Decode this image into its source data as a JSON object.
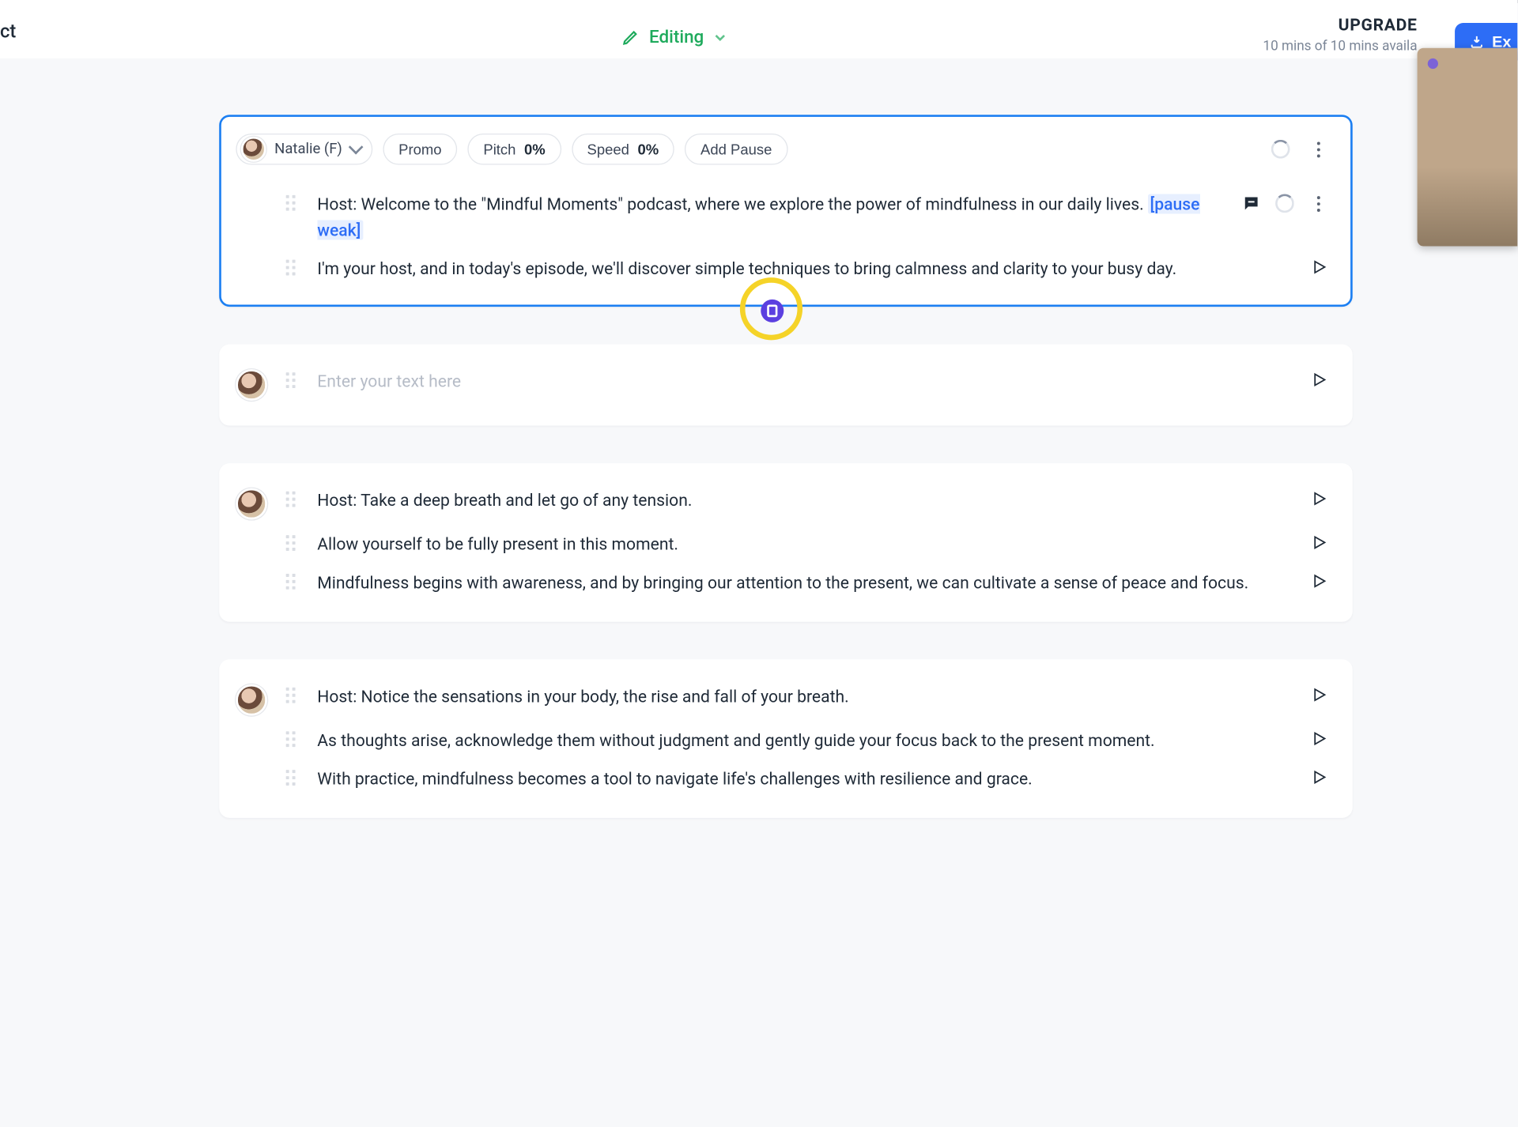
{
  "header": {
    "left_fragment": "ct",
    "mode_label": "Editing",
    "upgrade_label": "UPGRADE",
    "quota_text": "10 mins of 10 mins availa",
    "export_label": "Ex"
  },
  "toolbar": {
    "voice_name": "Natalie (F)",
    "promo_label": "Promo",
    "pitch_label": "Pitch",
    "pitch_value": "0%",
    "speed_label": "Speed",
    "speed_value": "0%",
    "add_pause_label": "Add Pause"
  },
  "blocks": [
    {
      "active": true,
      "has_toolbar": true,
      "lines": [
        {
          "text": "Host: Welcome to the \"Mindful Moments\" podcast, where we explore the power of mindfulness in our daily lives. ",
          "pause_tag": "[pause weak]",
          "show_comment": true,
          "show_spinner": true,
          "show_dots": true,
          "show_play": false
        },
        {
          "text": "I'm your host, and in today's episode, we'll discover simple techniques to bring calmness and clarity to your busy day.",
          "show_play": true
        }
      ]
    },
    {
      "active": false,
      "has_avatar_only": true,
      "placeholder": "Enter your text here",
      "show_play": true
    },
    {
      "active": false,
      "has_avatar_only": true,
      "lines": [
        {
          "text": "Host: Take a deep breath and let go of any tension.",
          "show_play": true
        },
        {
          "text": "Allow yourself to be fully present in this moment.",
          "show_play": true
        },
        {
          "text": "Mindfulness begins with awareness, and by bringing our attention to the present, we can cultivate a sense of peace and focus.",
          "show_play": true
        }
      ]
    },
    {
      "active": false,
      "has_avatar_only": true,
      "lines": [
        {
          "text": "Host: Notice the sensations in your body, the rise and fall of your breath.",
          "show_play": true
        },
        {
          "text": "As thoughts arise, acknowledge them without judgment and gently guide your focus back to the present moment.",
          "show_play": true
        },
        {
          "text": "With practice, mindfulness becomes a tool to navigate life's challenges with resilience and grace.",
          "show_play": true
        }
      ]
    }
  ]
}
